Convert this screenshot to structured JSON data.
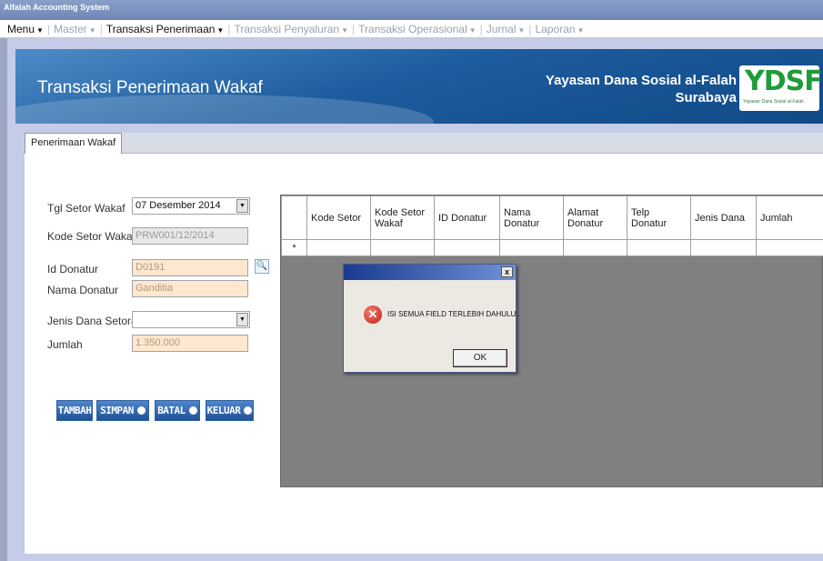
{
  "window": {
    "title": "Alfalah Accounting System"
  },
  "menu": [
    {
      "label": "Menu",
      "active": true
    },
    {
      "label": "Master",
      "active": false
    },
    {
      "label": "Transaksi Penerimaan",
      "active": true
    },
    {
      "label": "Transaksi Penyaluran",
      "active": false
    },
    {
      "label": "Transaksi Operasional",
      "active": false
    },
    {
      "label": "Jurnal",
      "active": false
    },
    {
      "label": "Laporan",
      "active": false
    }
  ],
  "banner": {
    "title": "Transaksi Penerimaan Wakaf",
    "org_line1": "Yayasan Dana Sosial al-Falah",
    "org_line2": "Surabaya",
    "logo_text": "YDSF",
    "logo_sub": "Yayasan Dana Sosial al-Falah"
  },
  "tab": {
    "label": "Penerimaan Wakaf"
  },
  "form": {
    "tgl_setor_label": "Tgl Setor Wakaf",
    "tgl_setor_value": "07 Desember 2014",
    "kode_setor_label": "Kode Setor Wakaf",
    "kode_setor_value": "PRW001/12/2014",
    "id_donatur_label": "Id Donatur",
    "id_donatur_value": "D0191",
    "nama_donatur_label": "Nama Donatur",
    "nama_donatur_value": "Ganditia",
    "jenis_dana_label": "Jenis Dana Setoran",
    "jenis_dana_value": "",
    "jumlah_label": "Jumlah",
    "jumlah_value": "1.350.000"
  },
  "buttons": {
    "tambah": "TAMBAH",
    "simpan": "SIMPAN",
    "batal": "BATAL",
    "keluar": "KELUAR"
  },
  "grid": {
    "columns": [
      "Kode Setor",
      "Kode Setor Wakaf",
      "ID Donatur",
      "Nama Donatur",
      "Alamat Donatur",
      "Telp Donatur",
      "Jenis Dana",
      "Jumlah"
    ],
    "new_row_marker": "*"
  },
  "dialog": {
    "message": "ISI SEMUA FIELD TERLEBIH DAHULU..",
    "ok_label": "OK",
    "close_label": "x"
  },
  "icons": {
    "dropdown": "chevron-down-icon",
    "lookup": "magnifier-icon",
    "error": "error-icon"
  }
}
